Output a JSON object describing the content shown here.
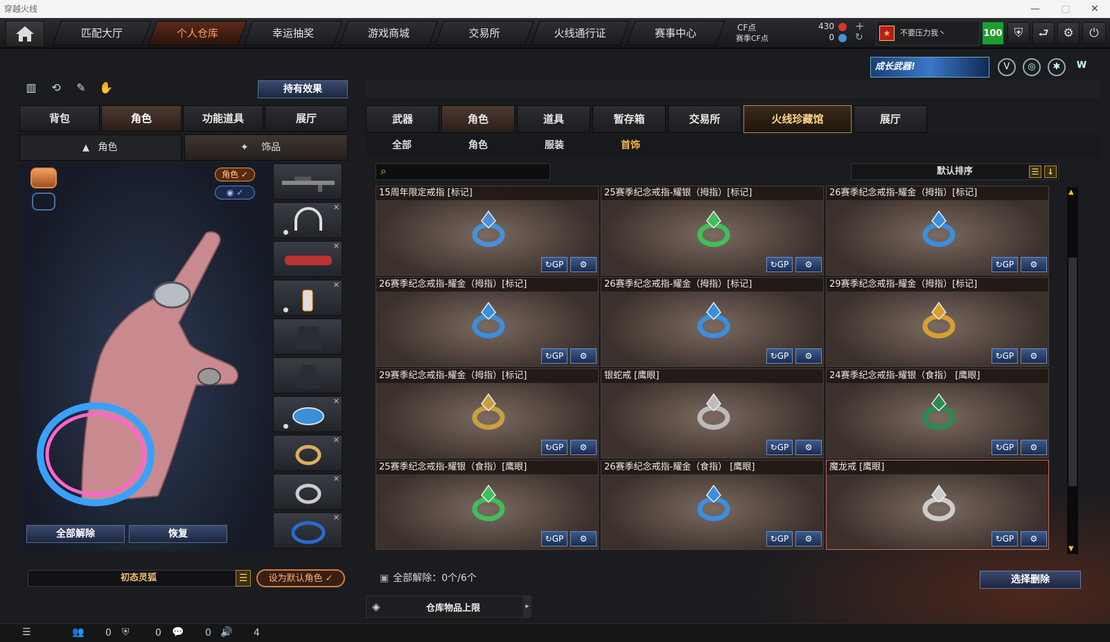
{
  "window": {
    "title": "穿越火线",
    "min": "—",
    "max": "□",
    "close": "✕"
  },
  "nav": {
    "tabs": [
      "匹配大厅",
      "个人仓库",
      "幸运抽奖",
      "游戏商城",
      "交易所",
      "火线通行证",
      "赛事中心"
    ],
    "active": "个人仓库"
  },
  "currency": {
    "cf_label": "CF点",
    "season_label": "赛季CF点",
    "cf_value": "430",
    "season_value": "0",
    "plus": "+",
    "refresh": "↻"
  },
  "rank": {
    "label": "不要压力我丶",
    "badge": "★"
  },
  "level": "100",
  "top_icons": {
    "shield": "⛨",
    "return": "⮐",
    "settings": "⚙",
    "power": "⏻"
  },
  "promo": {
    "banner": "成长武器!",
    "icons": [
      "V",
      "◎",
      "✱",
      "W"
    ]
  },
  "left": {
    "toolbar_icons": [
      "▥",
      "⟲",
      "✎",
      "✋"
    ],
    "effects_button": "持有效果",
    "tabs": [
      "背包",
      "角色",
      "功能道具",
      "展厅"
    ],
    "active_tab": "角色",
    "subtabs": {
      "char": "角色",
      "accessory": "饰品"
    },
    "char_pill": "角色 ✓",
    "eye_pill": "◉ ✓",
    "unequip_all": "全部解除",
    "restore": "恢复",
    "char_name": "初态灵狐",
    "set_default": "设为默认角色 ✓",
    "menu_icon": "☰"
  },
  "right": {
    "tabs": [
      "武器",
      "角色",
      "道具",
      "暂存箱",
      "交易所",
      "火线珍藏馆",
      "展厅"
    ],
    "active_tab": "角色",
    "gold_tab": "火线珍藏馆",
    "filters": [
      "全部",
      "角色",
      "服装",
      "首饰"
    ],
    "active_filter": "首饰",
    "search_placeholder": "",
    "sort_label": "默认排序",
    "gp_label": "↻GP",
    "gear": "⚙",
    "items": [
      {
        "name": "15周年限定戒指 [标记]"
      },
      {
        "name": "25赛季纪念戒指-耀银（拇指）[标记]"
      },
      {
        "name": "26赛季纪念戒指-耀金（拇指）[标记]"
      },
      {
        "name": "26赛季纪念戒指-耀金（拇指）[标记]"
      },
      {
        "name": "26赛季纪念戒指-耀金（拇指）[标记]"
      },
      {
        "name": "29赛季纪念戒指-耀金（拇指）[标记]"
      },
      {
        "name": "29赛季纪念戒指-耀金（拇指）[标记]"
      },
      {
        "name": "银蛇戒 [鹰眼]"
      },
      {
        "name": "24赛季纪念戒指-耀银（食指） [鹰眼]"
      },
      {
        "name": "25赛季纪念戒指-耀银（食指）[鹰眼]"
      },
      {
        "name": "26赛季纪念戒指-耀金（食指） [鹰眼]"
      },
      {
        "name": "魔龙戒 [鹰眼]"
      }
    ],
    "status": "全部解除：0个/6个",
    "delete_button": "选择删除",
    "capacity": "仓库物品上限"
  },
  "bottom": {
    "counts": [
      "0",
      "0",
      "0",
      "4"
    ]
  },
  "colors": {
    "accent_orange": "#ff9a60",
    "gold": "#f5b945",
    "level_green": "#1f9e2c"
  }
}
